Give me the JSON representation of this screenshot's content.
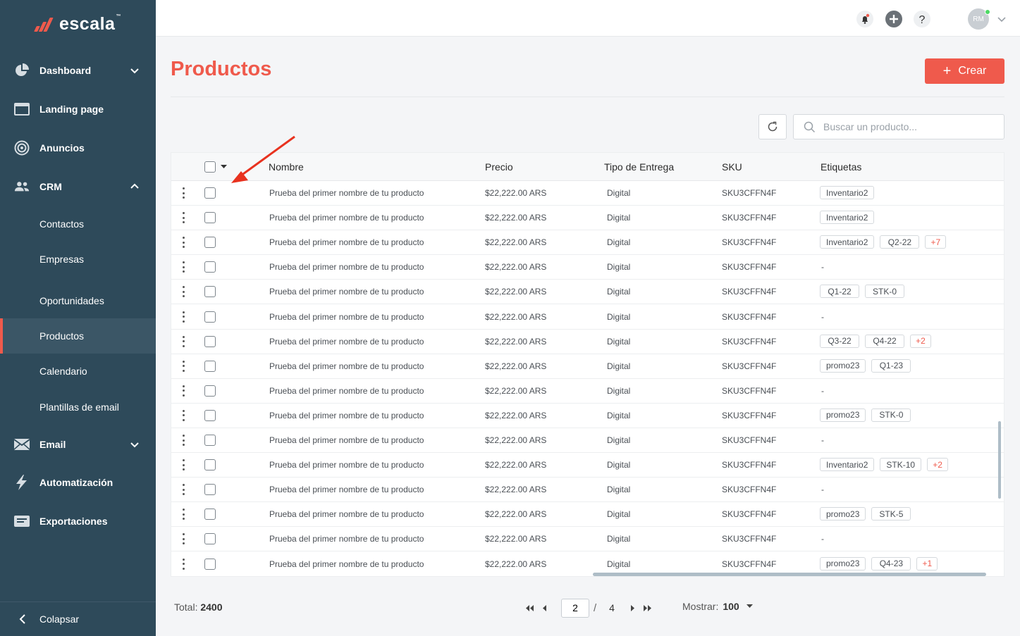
{
  "brand": {
    "name": "escala",
    "tm": "™"
  },
  "sidebar": {
    "items": [
      {
        "label": "Dashboard",
        "icon": "pie-chart-icon",
        "chevron": "down"
      },
      {
        "label": "Landing page",
        "icon": "browser-window-icon"
      },
      {
        "label": "Anuncios",
        "icon": "target-icon"
      },
      {
        "label": "CRM",
        "icon": "users-icon",
        "chevron": "up"
      },
      {
        "label": "Email",
        "icon": "envelope-icon",
        "chevron": "down"
      },
      {
        "label": "Automatización",
        "icon": "lightning-icon"
      },
      {
        "label": "Exportaciones",
        "icon": "export-list-icon"
      }
    ],
    "crm_sub": [
      "Contactos",
      "Empresas",
      "Oportunidades",
      "Productos",
      "Calendario",
      "Plantillas de email"
    ],
    "active": "Productos",
    "collapse_label": "Colapsar"
  },
  "topbar": {
    "icons": [
      "bell-icon",
      "plus-circle-icon",
      "help-icon"
    ],
    "avatar_initials": "RM"
  },
  "page": {
    "title": "Productos",
    "create_label": "Crear",
    "search_placeholder": "Buscar un producto..."
  },
  "table": {
    "headers": {
      "name": "Nombre",
      "price": "Precio",
      "delivery": "Tipo de Entrega",
      "sku": "SKU",
      "tags": "Etiquetas"
    },
    "rows": [
      {
        "name": "Prueba del primer nombre de tu producto",
        "price": "$22,222.00 ARS",
        "delivery": "Digital",
        "sku": "SKU3CFFN4F",
        "tags": [
          "Inventario2"
        ],
        "more": ""
      },
      {
        "name": "Prueba del primer nombre de tu producto",
        "price": "$22,222.00 ARS",
        "delivery": "Digital",
        "sku": "SKU3CFFN4F",
        "tags": [
          "Inventario2"
        ],
        "more": ""
      },
      {
        "name": "Prueba del primer nombre de tu producto",
        "price": "$22,222.00 ARS",
        "delivery": "Digital",
        "sku": "SKU3CFFN4F",
        "tags": [
          "Inventario2",
          "Q2-22"
        ],
        "more": "+7"
      },
      {
        "name": "Prueba del primer nombre de tu producto",
        "price": "$22,222.00 ARS",
        "delivery": "Digital",
        "sku": "SKU3CFFN4F",
        "tags": [],
        "more": ""
      },
      {
        "name": "Prueba del primer nombre de tu producto",
        "price": "$22,222.00 ARS",
        "delivery": "Digital",
        "sku": "SKU3CFFN4F",
        "tags": [
          "Q1-22",
          "STK-0"
        ],
        "more": ""
      },
      {
        "name": "Prueba del primer nombre de tu producto",
        "price": "$22,222.00 ARS",
        "delivery": "Digital",
        "sku": "SKU3CFFN4F",
        "tags": [],
        "more": ""
      },
      {
        "name": "Prueba del primer nombre de tu producto",
        "price": "$22,222.00 ARS",
        "delivery": "Digital",
        "sku": "SKU3CFFN4F",
        "tags": [
          "Q3-22",
          "Q4-22"
        ],
        "more": "+2"
      },
      {
        "name": "Prueba del primer nombre de tu producto",
        "price": "$22,222.00 ARS",
        "delivery": "Digital",
        "sku": "SKU3CFFN4F",
        "tags": [
          "promo23",
          "Q1-23"
        ],
        "more": ""
      },
      {
        "name": "Prueba del primer nombre de tu producto",
        "price": "$22,222.00 ARS",
        "delivery": "Digital",
        "sku": "SKU3CFFN4F",
        "tags": [],
        "more": ""
      },
      {
        "name": "Prueba del primer nombre de tu producto",
        "price": "$22,222.00 ARS",
        "delivery": "Digital",
        "sku": "SKU3CFFN4F",
        "tags": [
          "promo23",
          "STK-0"
        ],
        "more": ""
      },
      {
        "name": "Prueba del primer nombre de tu producto",
        "price": "$22,222.00 ARS",
        "delivery": "Digital",
        "sku": "SKU3CFFN4F",
        "tags": [],
        "more": ""
      },
      {
        "name": "Prueba del primer nombre de tu producto",
        "price": "$22,222.00 ARS",
        "delivery": "Digital",
        "sku": "SKU3CFFN4F",
        "tags": [
          "Inventario2",
          "STK-10"
        ],
        "more": "+2"
      },
      {
        "name": "Prueba del primer nombre de tu producto",
        "price": "$22,222.00 ARS",
        "delivery": "Digital",
        "sku": "SKU3CFFN4F",
        "tags": [],
        "more": ""
      },
      {
        "name": "Prueba del primer nombre de tu producto",
        "price": "$22,222.00 ARS",
        "delivery": "Digital",
        "sku": "SKU3CFFN4F",
        "tags": [
          "promo23",
          "STK-5"
        ],
        "more": ""
      },
      {
        "name": "Prueba del primer nombre de tu producto",
        "price": "$22,222.00 ARS",
        "delivery": "Digital",
        "sku": "SKU3CFFN4F",
        "tags": [],
        "more": ""
      },
      {
        "name": "Prueba del primer nombre de tu producto",
        "price": "$22,222.00 ARS",
        "delivery": "Digital",
        "sku": "SKU3CFFN4F",
        "tags": [
          "promo23",
          "Q4-23"
        ],
        "more": "+1"
      }
    ],
    "empty_tag": "-"
  },
  "footer": {
    "total_label": "Total:",
    "total_value": "2400",
    "current_page": "2",
    "page_sep": "/",
    "total_pages": "4",
    "show_label": "Mostrar:",
    "show_value": "100"
  },
  "colors": {
    "accent": "#ef5a4c",
    "sidebar": "#2e4a5a"
  }
}
